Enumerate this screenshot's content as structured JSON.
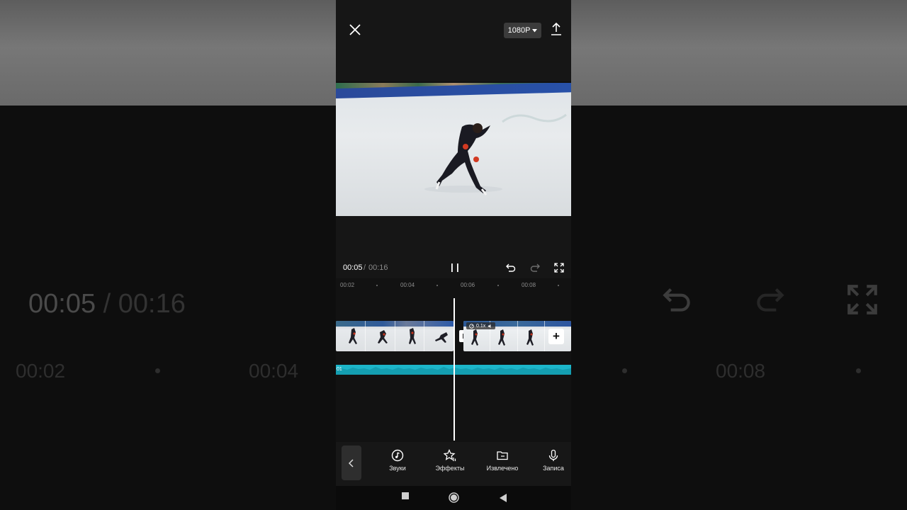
{
  "app": {
    "resolution_label": "1080P",
    "time_current": "00:05",
    "time_separator": "/",
    "time_total": "00:16"
  },
  "ruler": {
    "ticks": [
      "00:02",
      "00:04",
      "00:06",
      "00:08"
    ]
  },
  "clips": {
    "speed_tag": "0.1x",
    "audio_label": "01",
    "playhead_position": 0.5
  },
  "toolbar": {
    "items": [
      {
        "label": "Звуки",
        "icon": "music-note-icon"
      },
      {
        "label": "Эффекты",
        "icon": "star-effects-icon"
      },
      {
        "label": "Извлечено",
        "icon": "folder-icon"
      },
      {
        "label": "Записа",
        "icon": "microphone-icon"
      }
    ]
  },
  "background": {
    "ghost_time_current": "00:05",
    "ghost_time_separator": "/",
    "ghost_time_total": "00:16",
    "ghost_ticks": [
      "00:02",
      "00:04",
      "00:08"
    ]
  },
  "colors": {
    "audio_track": "#1cb5c9",
    "panel": "#161616",
    "accent_white": "#ffffff"
  }
}
